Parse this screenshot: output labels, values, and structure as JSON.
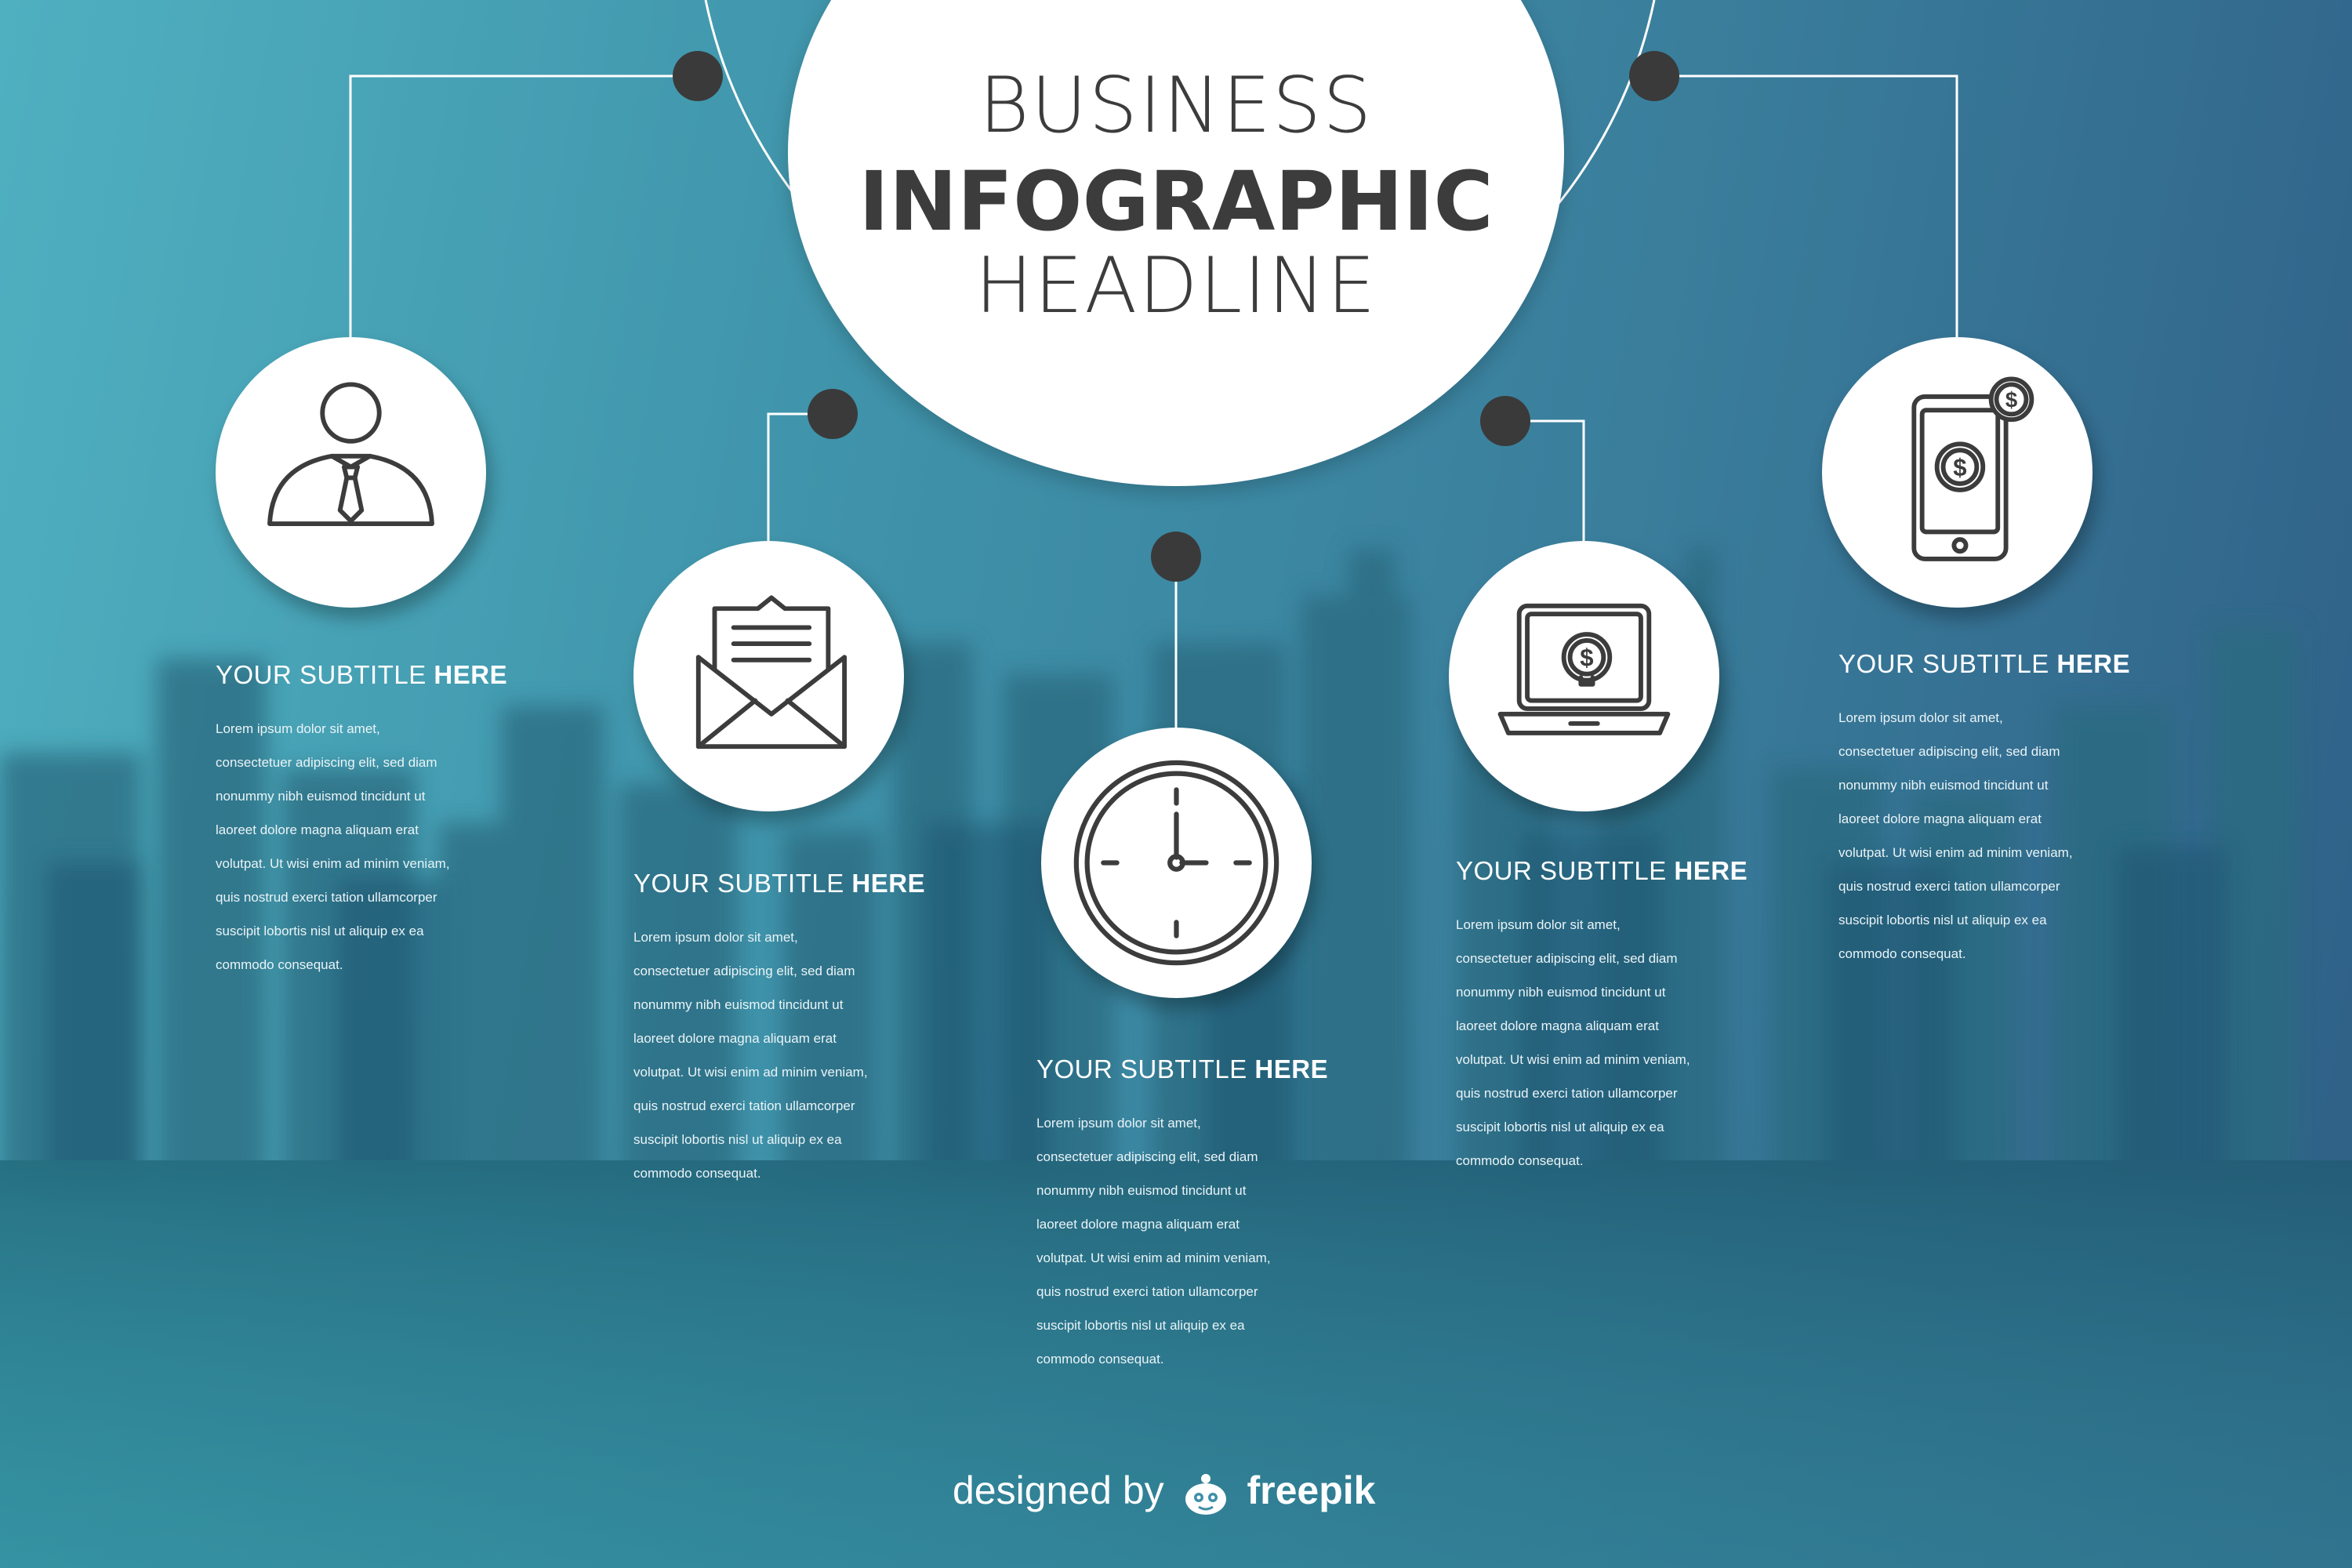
{
  "headline": {
    "line1": "BUSINESS",
    "line2": "INFOGRAPHIC",
    "line3": "HEADLINE"
  },
  "items": [
    {
      "icon": "businessman-icon",
      "subtitle_regular": "YOUR SUBTITLE ",
      "subtitle_bold": "HERE",
      "body": [
        "Lorem ipsum dolor sit amet,",
        "consectetuer adipiscing elit, sed diam",
        "nonummy nibh euismod tincidunt ut",
        "laoreet dolore magna aliquam erat",
        "volutpat. Ut wisi enim ad minim veniam,",
        "quis nostrud exerci tation ullamcorper",
        "suscipit lobortis nisl ut aliquip ex ea",
        "commodo consequat."
      ]
    },
    {
      "icon": "envelope-letter-icon",
      "subtitle_regular": "YOUR SUBTITLE ",
      "subtitle_bold": "HERE",
      "body": [
        "Lorem ipsum dolor sit amet,",
        "consectetuer adipiscing elit, sed diam",
        "nonummy nibh euismod tincidunt ut",
        "laoreet dolore magna aliquam erat",
        "volutpat. Ut wisi enim ad minim veniam,",
        "quis nostrud exerci tation ullamcorper",
        "suscipit lobortis nisl ut aliquip ex ea",
        "commodo consequat."
      ]
    },
    {
      "icon": "clock-icon",
      "subtitle_regular": "YOUR SUBTITLE ",
      "subtitle_bold": "HERE",
      "body": [
        "Lorem ipsum dolor sit amet,",
        "consectetuer adipiscing elit, sed diam",
        "nonummy nibh euismod tincidunt ut",
        "laoreet dolore magna aliquam erat",
        "volutpat. Ut wisi enim ad minim veniam,",
        "quis nostrud exerci tation ullamcorper",
        "suscipit lobortis nisl ut aliquip ex ea",
        "commodo consequat."
      ]
    },
    {
      "icon": "laptop-dollar-icon",
      "subtitle_regular": "YOUR SUBTITLE ",
      "subtitle_bold": "HERE",
      "body": [
        "Lorem ipsum dolor sit amet,",
        "consectetuer adipiscing elit, sed diam",
        "nonummy nibh euismod tincidunt ut",
        "laoreet dolore magna aliquam erat",
        "volutpat. Ut wisi enim ad minim veniam,",
        "quis nostrud exerci tation ullamcorper",
        "suscipit lobortis nisl ut aliquip ex ea",
        "commodo consequat."
      ]
    },
    {
      "icon": "phone-dollar-icon",
      "subtitle_regular": "YOUR SUBTITLE ",
      "subtitle_bold": "HERE",
      "body": [
        "Lorem ipsum dolor sit amet,",
        "consectetuer adipiscing elit, sed diam",
        "nonummy nibh euismod tincidunt ut",
        "laoreet dolore magna aliquam erat",
        "volutpat. Ut wisi enim ad minim veniam,",
        "quis nostrud exerci tation ullamcorper",
        "suscipit lobortis nisl ut aliquip ex ea",
        "commodo consequat."
      ]
    }
  ],
  "credit": {
    "prefix": "designed by",
    "brand": "freepik",
    "mascot": "freepik-mascot-icon"
  },
  "colors": {
    "bg_left": "#4fb0c0",
    "bg_right": "#2f5f86",
    "node_dot": "#3a3a3a",
    "icon_stroke": "#3c3c3c",
    "text": "#ffffff"
  }
}
